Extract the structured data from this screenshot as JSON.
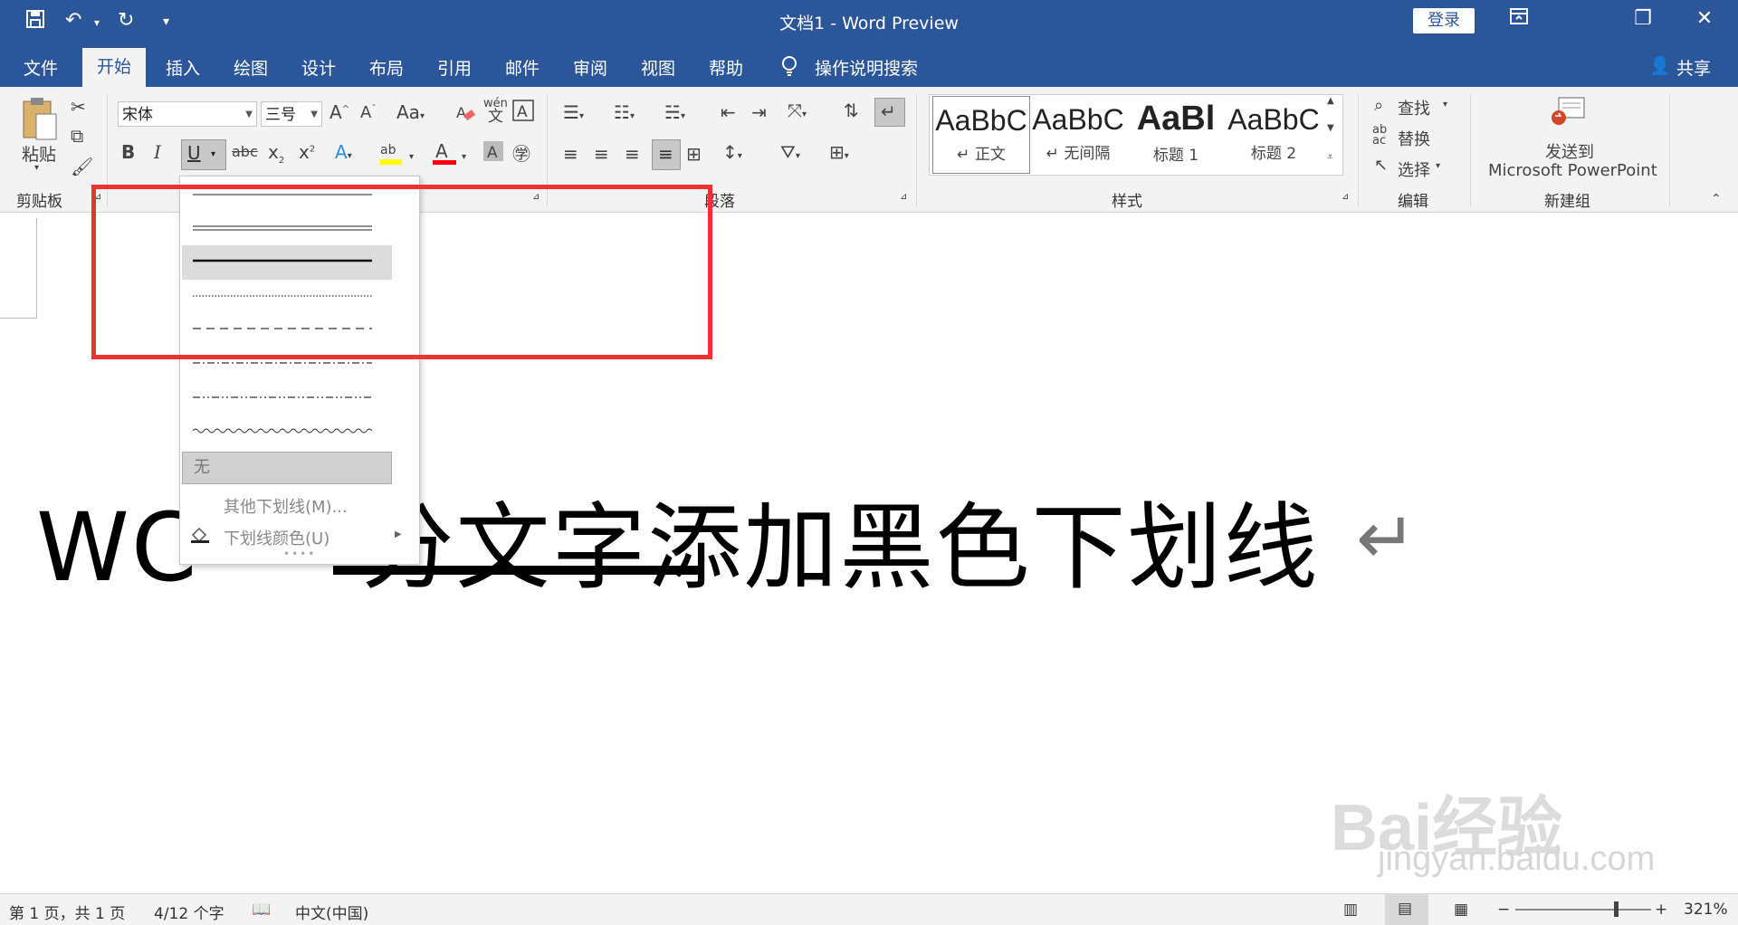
{
  "titlebar": {
    "title": "文档1  -  Word Preview",
    "login_label": "登录",
    "icons": [
      "save-icon",
      "undo-icon",
      "redo-icon",
      "customize-qat-icon",
      "ribbon-display-icon",
      "restore-icon",
      "close-icon"
    ]
  },
  "tabs": {
    "items": [
      "文件",
      "开始",
      "插入",
      "绘图",
      "设计",
      "布局",
      "引用",
      "邮件",
      "审阅",
      "视图",
      "帮助"
    ],
    "tell_me": "操作说明搜索",
    "share": "共享"
  },
  "ribbon": {
    "clipboard": {
      "paste_label": "粘贴",
      "group_label": "剪贴板"
    },
    "font": {
      "font_name": "宋体",
      "font_size": "三号"
    },
    "paragraph": {
      "group_label": "段落"
    },
    "styles": {
      "group_label": "样式",
      "items": [
        {
          "sample": "AaBbC",
          "name": "↵ 正文"
        },
        {
          "sample": "AaBbC",
          "name": "↵ 无间隔"
        },
        {
          "sample": "AaBl",
          "name": "标题 1"
        },
        {
          "sample": "AaBbC",
          "name": "标题 2"
        }
      ]
    },
    "editing": {
      "find": "查找",
      "replace": "替换",
      "select": "选择",
      "group_label": "编辑"
    },
    "newgroup": {
      "send_line1": "发送到",
      "send_line2": "Microsoft PowerPoint",
      "group_label": "新建组"
    }
  },
  "underline_menu": {
    "none_label": "无",
    "more_label": "其他下划线(M)...",
    "color_label": "下划线颜色(U)"
  },
  "document": {
    "text_start": "WC",
    "text_mid": "分文字",
    "text_end": "添加黑色下划线",
    "para_mark": "↵"
  },
  "statusbar": {
    "page": "第 1 页，共 1 页",
    "words": "4/12 个字",
    "language": "中文(中国)",
    "zoom": "321%"
  },
  "watermark": {
    "logo": "Bai经验",
    "sub": "jingyan.baidu.com"
  },
  "colors": {
    "accent": "#2b579a",
    "highlight": "#ee3333",
    "font_color": "#ff0000",
    "highlight_color": "#ffff00"
  }
}
